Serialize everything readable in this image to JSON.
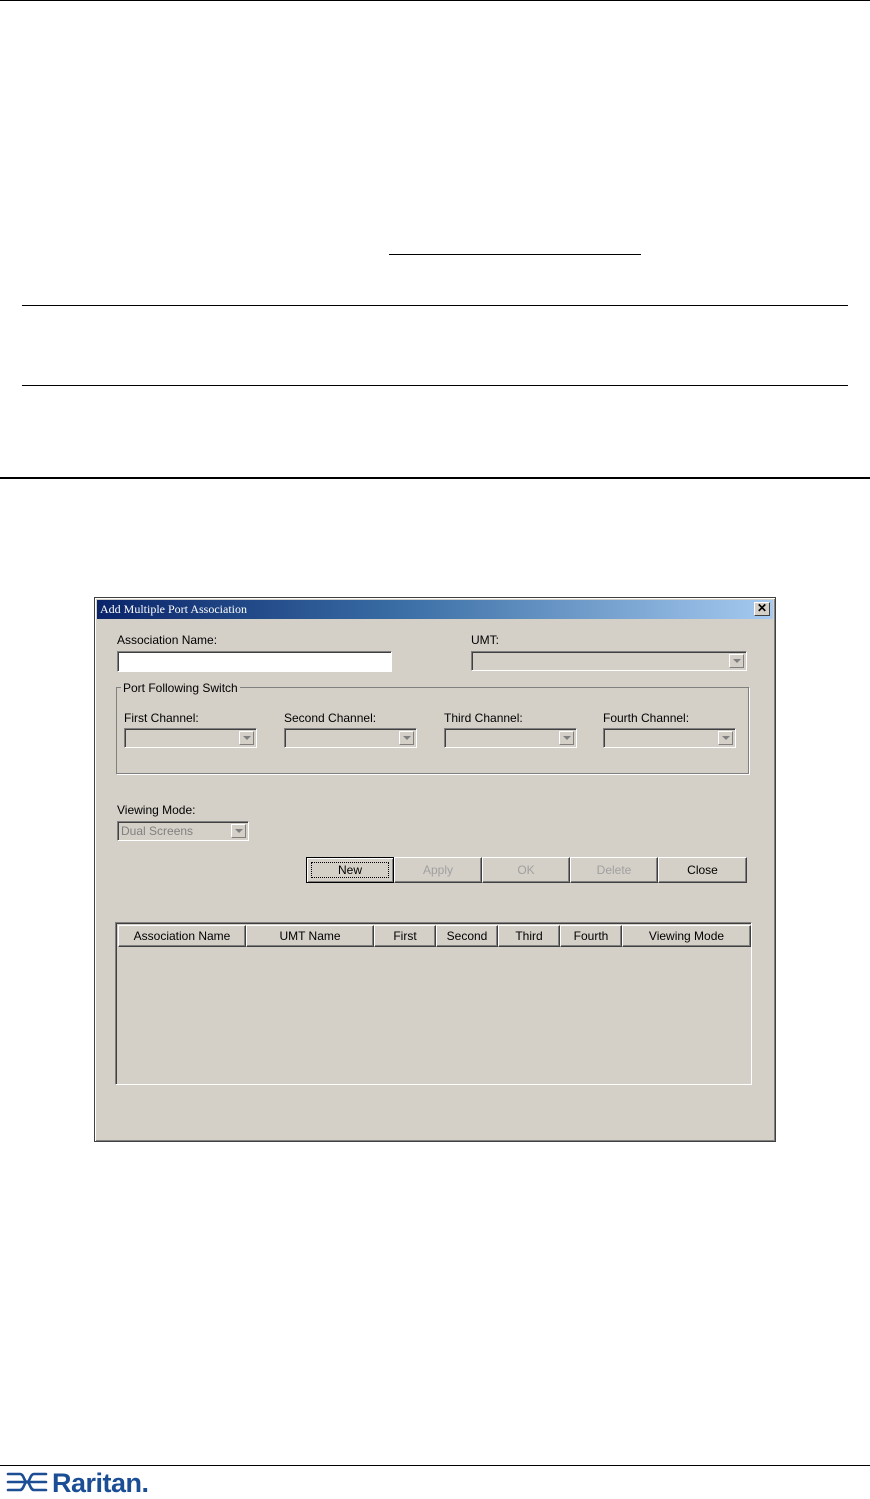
{
  "dialog": {
    "title": "Add Multiple Port Association",
    "close_glyph": "✕",
    "association_name_label": "Association Name:",
    "association_name_value": "",
    "umt_label": "UMT:",
    "umt_value": "",
    "port_following_switch_label": "Port Following Switch",
    "channels": [
      {
        "label": "First Channel:",
        "value": ""
      },
      {
        "label": "Second Channel:",
        "value": ""
      },
      {
        "label": "Third Channel:",
        "value": ""
      },
      {
        "label": "Fourth Channel:",
        "value": ""
      }
    ],
    "viewing_mode_label": "Viewing Mode:",
    "viewing_mode_value": "Dual Screens",
    "buttons": {
      "new": "New",
      "apply": "Apply",
      "ok": "OK",
      "delete": "Delete",
      "close": "Close"
    },
    "table_headers": [
      "Association Name",
      "UMT Name",
      "First",
      "Second",
      "Third",
      "Fourth",
      "Viewing Mode"
    ],
    "table_rows": []
  },
  "footer": {
    "brand": "Raritan."
  },
  "colors": {
    "dialog_face": "#d4d0c8",
    "titlebar_start": "#0a246a",
    "titlebar_end": "#a6caf0",
    "brand_blue": "#1c4e96"
  }
}
